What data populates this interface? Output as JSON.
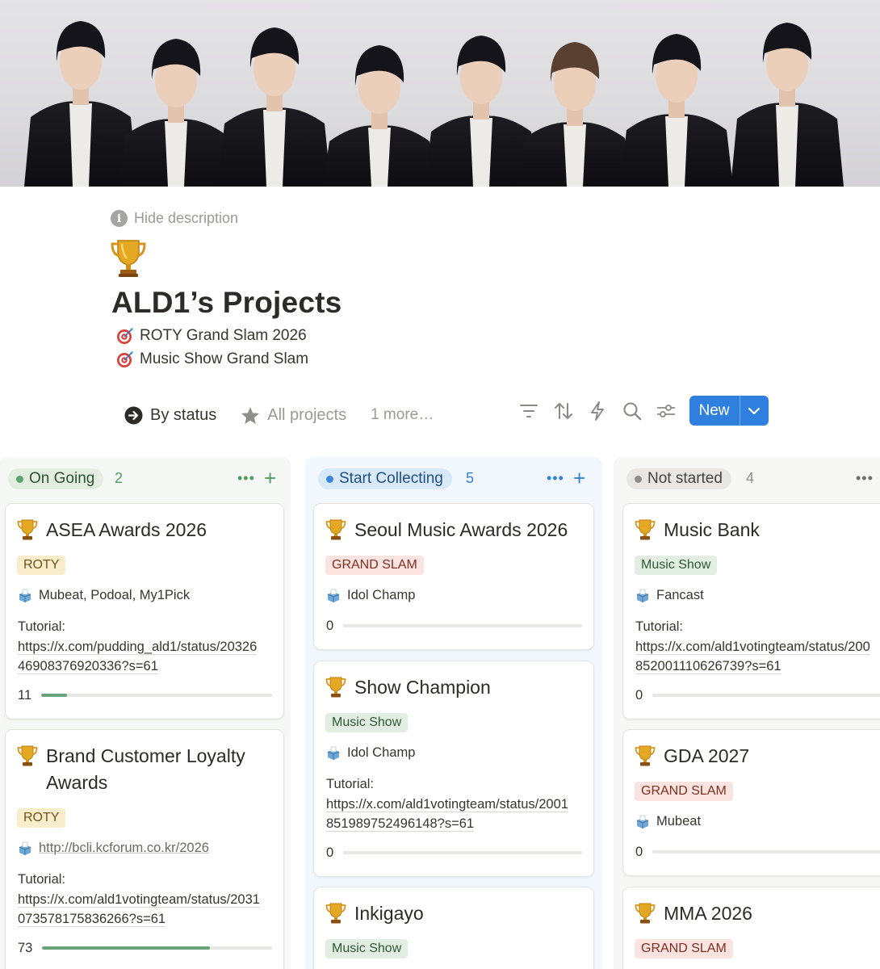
{
  "description": {
    "hide_label": "Hide description",
    "info_icon": "i"
  },
  "page": {
    "icon": "trophy-icon",
    "title": "ALD1’s Projects",
    "goals": [
      "ROTY Grand Slam 2026",
      "Music Show Grand Slam"
    ]
  },
  "views": {
    "tabs": [
      {
        "label": "By status",
        "icon": "arrow-circle-icon",
        "active": true
      },
      {
        "label": "All projects",
        "icon": "star-icon",
        "active": false
      }
    ],
    "more_label": "1 more…"
  },
  "toolbar": {
    "icons": [
      "filter-icon",
      "sort-icon",
      "lightning-icon",
      "search-icon",
      "settings-sliders-icon"
    ],
    "new_label": "New",
    "accent": "#2f7fde"
  },
  "columns": [
    {
      "status": "On Going",
      "count": "2",
      "color": "#4c9f62",
      "bg": "#e4efe3",
      "cards": [
        {
          "title": "ASEA Awards 2026",
          "tag": "ROTY",
          "tag_kind": "roty",
          "platform": "Mubeat, Podoal, My1Pick",
          "tutorial_label": "Tutorial:",
          "tutorial_url_1": "https://x.com/pudding_ald1/status/20326",
          "tutorial_url_2": "46908376920336?s=61",
          "progress_text": "11",
          "progress": 0.11
        },
        {
          "title_1": "Brand Customer Loyalty",
          "title_2": "Awards",
          "tag": "ROTY",
          "tag_kind": "roty",
          "platform": "http://bcli.kcforum.co.kr/2026",
          "tutorial_label": "Tutorial:",
          "tutorial_url_1": "https://x.com/ald1votingteam/status/2031",
          "tutorial_url_2": "073578175836266?s=61",
          "progress_text": "73",
          "progress": 0.73
        }
      ]
    },
    {
      "status": "Start Collecting",
      "count": "5",
      "color": "#3580d8",
      "bg": "#dcebfa",
      "cards": [
        {
          "title": "Seoul Music Awards 2026",
          "tag": "GRAND SLAM",
          "tag_kind": "slam",
          "platform": "Idol Champ",
          "progress_text": "0",
          "progress": 0
        },
        {
          "title": "Show Champion",
          "tag": "Music Show",
          "tag_kind": "show",
          "platform": "Idol Champ",
          "tutorial_label": "Tutorial:",
          "tutorial_url_1": "https://x.com/ald1votingteam/status/2001",
          "tutorial_url_2": "851989752496148?s=61",
          "progress_text": "0",
          "progress": 0
        },
        {
          "title": "Inkigayo",
          "tag": "Music Show",
          "tag_kind": "show"
        }
      ]
    },
    {
      "status": "Not started",
      "count": "4",
      "color": "#8e8d8a",
      "bg": "#ebeae8",
      "cards": [
        {
          "title": "Music Bank",
          "tag": "Music Show",
          "tag_kind": "show",
          "platform": "Fancast",
          "tutorial_label": "Tutorial:",
          "tutorial_url_1": "https://x.com/ald1votingteam/status/200",
          "tutorial_url_2": "852001110626739?s=61",
          "progress_text": "0",
          "progress": 0
        },
        {
          "title": "GDA 2027",
          "tag": "GRAND SLAM",
          "tag_kind": "slam",
          "platform": "Mubeat",
          "progress_text": "0",
          "progress": 0
        },
        {
          "title": "MMA 2026",
          "tag": "GRAND SLAM",
          "tag_kind": "slam"
        }
      ]
    }
  ]
}
